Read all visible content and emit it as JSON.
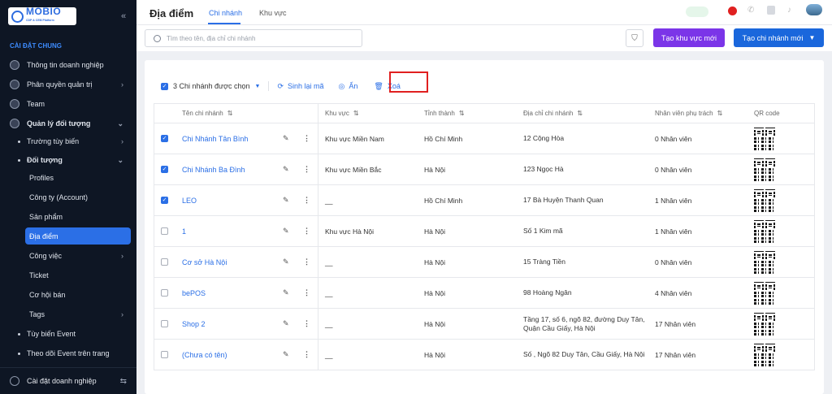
{
  "brand": {
    "name": "MOBIO",
    "tagline": "CDP & CEM Platform"
  },
  "sidebar": {
    "section": "CÀI ĐẶT CHUNG",
    "items": [
      {
        "label": "Thông tin doanh nghiệp"
      },
      {
        "label": "Phân quyền quản trị"
      },
      {
        "label": "Team"
      },
      {
        "label": "Quản lý đối tượng"
      }
    ],
    "sub": [
      {
        "label": "Trường tùy biến"
      },
      {
        "label": "Đối tượng"
      }
    ],
    "subsub": [
      {
        "label": "Profiles"
      },
      {
        "label": "Công ty (Account)"
      },
      {
        "label": "Sản phẩm"
      },
      {
        "label": "Địa điểm"
      },
      {
        "label": "Công việc"
      },
      {
        "label": "Ticket"
      },
      {
        "label": "Cơ hội bán"
      },
      {
        "label": "Tags"
      }
    ],
    "more": [
      {
        "label": "Tùy biến Event"
      },
      {
        "label": "Theo dõi Event trên trang"
      }
    ],
    "bottom": "Cài đặt doanh nghiệp"
  },
  "header": {
    "title": "Địa điểm",
    "tabs": [
      "Chi nhánh",
      "Khu vực"
    ]
  },
  "search": {
    "placeholder": "Tìm theo tên, địa chỉ chi nhánh"
  },
  "buttons": {
    "create_region": "Tạo khu vực mới",
    "create_branch": "Tạo chi nhánh mới"
  },
  "toolbar": {
    "selected": "3 Chi nhánh được chọn",
    "regen": "Sinh lại mã",
    "hide": "Ẩn",
    "delete": "Xoá"
  },
  "columns": [
    "Tên chi nhánh",
    "Khu vực",
    "Tỉnh thành",
    "Địa chỉ chi nhánh",
    "Nhân viên phụ trách",
    "QR code"
  ],
  "rows": [
    {
      "checked": true,
      "name": "Chi Nhánh Tân Bình",
      "region": "Khu vực Miền Nam",
      "province": "Hồ Chí Minh",
      "address": "12 Cộng Hòa",
      "staff": "0 Nhân viên"
    },
    {
      "checked": true,
      "name": "Chi Nhánh Ba Đình",
      "region": "Khu vực Miền Bắc",
      "province": "Hà Nội",
      "address": "123 Ngọc Hà",
      "staff": "0 Nhân viên"
    },
    {
      "checked": true,
      "name": "LEO",
      "region": "__",
      "province": "Hồ Chí Minh",
      "address": "17 Bà Huyện Thanh Quan",
      "staff": "1 Nhân viên"
    },
    {
      "checked": false,
      "name": "1",
      "region": "Khu vực Hà Nội",
      "province": "Hà Nội",
      "address": "Số 1 Kim mã",
      "staff": "1 Nhân viên"
    },
    {
      "checked": false,
      "name": "Cơ sở Hà Nội",
      "region": "__",
      "province": "Hà Nội",
      "address": "15 Tràng Tiền",
      "staff": "0 Nhân viên"
    },
    {
      "checked": false,
      "name": "bePOS",
      "region": "__",
      "province": "Hà Nội",
      "address": "98 Hoàng Ngân",
      "staff": "4 Nhân viên"
    },
    {
      "checked": false,
      "name": "Shop 2",
      "region": "__",
      "province": "Hà Nội",
      "address": "Tầng 17, số 6, ngõ 82, đường Duy Tân, Quận Cầu Giấy, Hà Nội",
      "staff": "17 Nhân viên"
    },
    {
      "checked": false,
      "name": "(Chưa có tên)",
      "region": "__",
      "province": "Hà Nội",
      "address": "Số , Ngõ 82 Duy Tân, Cầu Giấy, Hà Nội",
      "staff": "17 Nhân viên"
    }
  ],
  "colors": {
    "accent": "#2b6fe6",
    "purple": "#7b35e8",
    "sidebar": "#0e1624",
    "highlight": "#e02020"
  }
}
